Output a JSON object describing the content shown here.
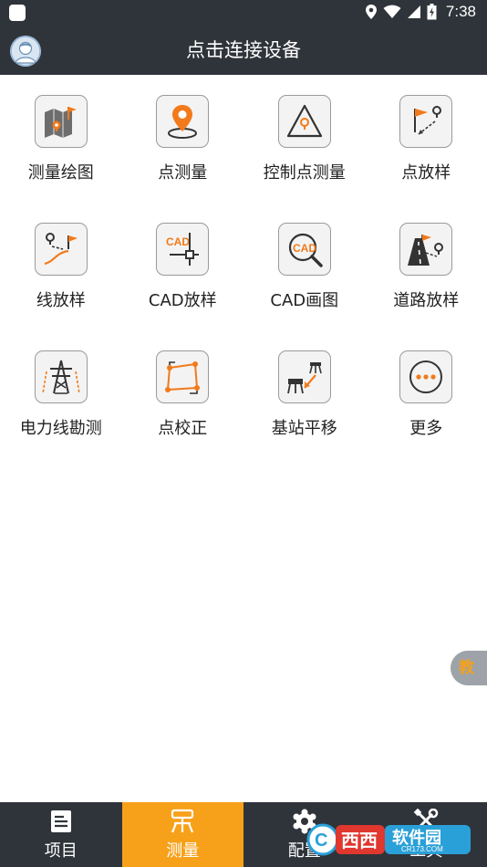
{
  "status_bar": {
    "time": "7:38"
  },
  "header": {
    "title": "点击连接设备"
  },
  "tools": [
    {
      "label": "测量绘图",
      "icon": "map-draw-icon"
    },
    {
      "label": "点测量",
      "icon": "point-survey-icon"
    },
    {
      "label": "控制点测量",
      "icon": "control-point-icon"
    },
    {
      "label": "点放样",
      "icon": "point-stakeout-icon"
    },
    {
      "label": "线放样",
      "icon": "line-stakeout-icon"
    },
    {
      "label": "CAD放样",
      "icon": "cad-stakeout-icon"
    },
    {
      "label": "CAD画图",
      "icon": "cad-drawing-icon"
    },
    {
      "label": "道路放样",
      "icon": "road-stakeout-icon"
    },
    {
      "label": "电力线勘测",
      "icon": "power-line-icon"
    },
    {
      "label": "点校正",
      "icon": "point-calibration-icon"
    },
    {
      "label": "基站平移",
      "icon": "base-shift-icon"
    },
    {
      "label": "更多",
      "icon": "more-icon"
    }
  ],
  "float_button": {
    "label": "教"
  },
  "bottom_nav": [
    {
      "label": "项目",
      "icon": "project-icon",
      "active": false
    },
    {
      "label": "测量",
      "icon": "survey-icon",
      "active": true
    },
    {
      "label": "配置",
      "icon": "config-gear-icon",
      "active": false
    },
    {
      "label": "工具",
      "icon": "tools-icon",
      "active": false
    }
  ],
  "watermark": {
    "text": "软件园",
    "subtext": "CR173.COM"
  },
  "colors": {
    "bar": "#2f343a",
    "accent": "#f7a11a",
    "orange_icon": "#f27a1a"
  }
}
